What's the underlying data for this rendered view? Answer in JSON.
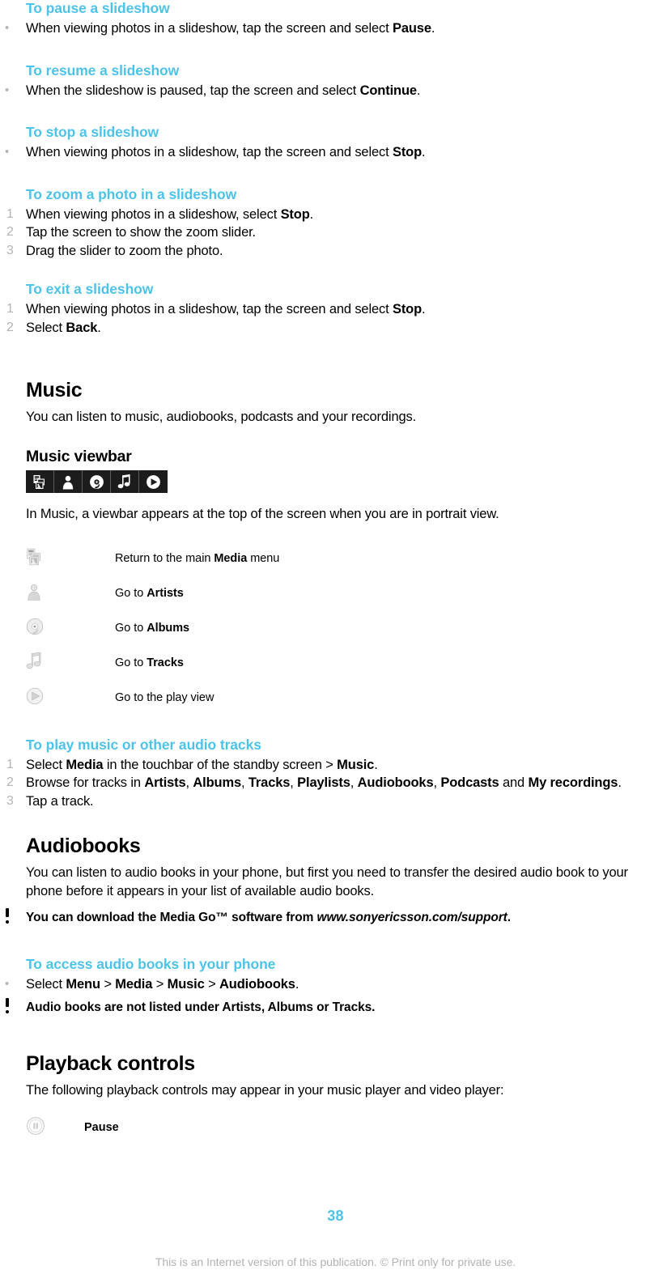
{
  "page": {
    "number": "38",
    "footer_note": "This is an Internet version of this publication. © Print only for private use.",
    "accent_color": "#4ec3e8",
    "marker_color": "#b4b4b4"
  },
  "sections": {
    "pause_slideshow": {
      "heading": "To pause a slideshow",
      "bullet_marker": "•",
      "item_1_pre": "When viewing photos in a slideshow, tap the screen and select ",
      "item_1_bold": "Pause",
      "item_1_post": "."
    },
    "resume_slideshow": {
      "heading": "To resume a slideshow",
      "bullet_marker": "•",
      "item_1_pre": "When the slideshow is paused, tap the screen and select ",
      "item_1_bold": "Continue",
      "item_1_post": "."
    },
    "stop_slideshow": {
      "heading": "To stop a slideshow",
      "bullet_marker": "•",
      "item_1_pre": "When viewing photos in a slideshow, tap the screen and select ",
      "item_1_bold": "Stop",
      "item_1_post": "."
    },
    "zoom_photo": {
      "heading": "To zoom a photo in a slideshow",
      "step_1_num": "1",
      "step_1_pre": "When viewing photos in a slideshow, select ",
      "step_1_bold": "Stop",
      "step_1_post": ".",
      "step_2_num": "2",
      "step_2_text": "Tap the screen to show the zoom slider.",
      "step_3_num": "3",
      "step_3_text": "Drag the slider to zoom the photo."
    },
    "exit_slideshow": {
      "heading": "To exit a slideshow",
      "step_1_num": "1",
      "step_1_pre": "When viewing photos in a slideshow, tap the screen and select ",
      "step_1_bold": "Stop",
      "step_1_post": ".",
      "step_2_num": "2",
      "step_2_pre": "Select ",
      "step_2_bold": "Back",
      "step_2_post": "."
    },
    "music": {
      "heading": "Music",
      "intro": "You can listen to music, audiobooks, podcasts and your recordings.",
      "viewbar_heading": "Music viewbar",
      "viewbar_caption": "In Music, a viewbar appears at the top of the screen when you are in portrait view.",
      "viewbar_icons": [
        {
          "name": "media-stack-icon",
          "label": "Return to the main Media menu"
        },
        {
          "name": "artist-person-icon",
          "label": "Go to Artists"
        },
        {
          "name": "album-disc-icon",
          "label": "Go to Albums"
        },
        {
          "name": "track-note-icon",
          "label": "Go to Tracks"
        },
        {
          "name": "play-view-icon",
          "label": "Go to the play view"
        }
      ],
      "icon_table": [
        {
          "icon": "media-stack-icon",
          "pre": "Return to the main ",
          "bold": "Media",
          "post": " menu"
        },
        {
          "icon": "artist-person-icon",
          "pre": "Go to ",
          "bold": "Artists",
          "post": ""
        },
        {
          "icon": "album-disc-icon",
          "pre": "Go to ",
          "bold": "Albums",
          "post": ""
        },
        {
          "icon": "track-note-icon",
          "pre": "Go to ",
          "bold": "Tracks",
          "post": ""
        },
        {
          "icon": "play-view-icon",
          "pre": "Go to the play view",
          "bold": "",
          "post": ""
        }
      ]
    },
    "play_music": {
      "heading": "To play music or other audio tracks",
      "step_1_num": "1",
      "step_1_a": "Select ",
      "step_1_b1": "Media",
      "step_1_b": " in the touchbar of the standby screen > ",
      "step_1_b2": "Music",
      "step_1_c": ".",
      "step_2_num": "2",
      "step_2_a": "Browse for tracks in ",
      "step_2_b1": "Artists",
      "step_2_b2": "Albums",
      "step_2_b3": "Tracks",
      "step_2_b4": "Playlists",
      "step_2_b5": "Audiobooks",
      "step_2_b6": "Podcasts",
      "step_2_and": " and ",
      "step_2_b7": "My recordings",
      "step_2_end": ".",
      "step_3_num": "3",
      "step_3_text": "Tap a track."
    },
    "audiobooks": {
      "heading": "Audiobooks",
      "intro": "You can listen to audio books in your phone, but first you need to transfer the desired audio book to your phone before it appears in your list of available audio books.",
      "tip_pre": "You can download the Media Go™ software from ",
      "tip_link": "www.sonyericsson.com/support",
      "tip_post": "."
    },
    "access_audiobooks": {
      "heading": "To access audio books in your phone",
      "bullet_marker": "•",
      "item_a": "Select ",
      "item_b1": "Menu",
      "item_sep1": " > ",
      "item_b2": "Media",
      "item_sep2": " > ",
      "item_b3": "Music",
      "item_sep3": " > ",
      "item_b4": "Audiobooks",
      "item_end": ".",
      "note": "Audio books are not listed under Artists, Albums or Tracks."
    },
    "playback_controls": {
      "heading": "Playback controls",
      "intro": "The following playback controls may appear in your music player and video player:",
      "rows": [
        {
          "icon": "pause-circle-icon",
          "label": "Pause"
        }
      ]
    }
  }
}
